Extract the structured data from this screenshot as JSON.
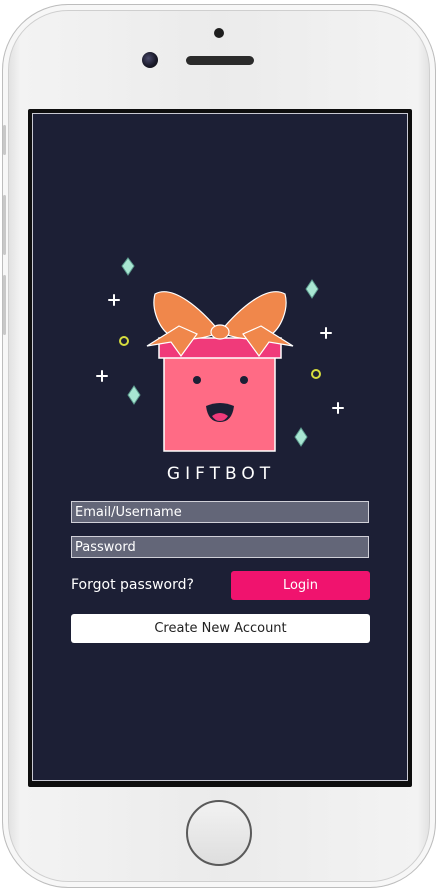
{
  "app": {
    "name": "GIFTBOT"
  },
  "login_form": {
    "email_placeholder": "Email/Username",
    "password_placeholder": "Password",
    "forgot_password_label": "Forgot password?",
    "login_label": "Login",
    "create_account_label": "Create New Account"
  },
  "colors": {
    "background": "#1c1f35",
    "accent": "#f0136e",
    "field_fill": "#636678",
    "gift_box": "#ff6b85",
    "gift_lid": "#f03a7a",
    "bow": "#f0874b",
    "sparkle_diamond": "#a8e6d2",
    "sparkle_circle": "#d6dd3e"
  },
  "icons": {
    "logo": "gift-box-mascot-icon",
    "sparkles": [
      "diamond-sparkle-icon",
      "plus-sparkle-icon",
      "circle-sparkle-icon"
    ]
  }
}
